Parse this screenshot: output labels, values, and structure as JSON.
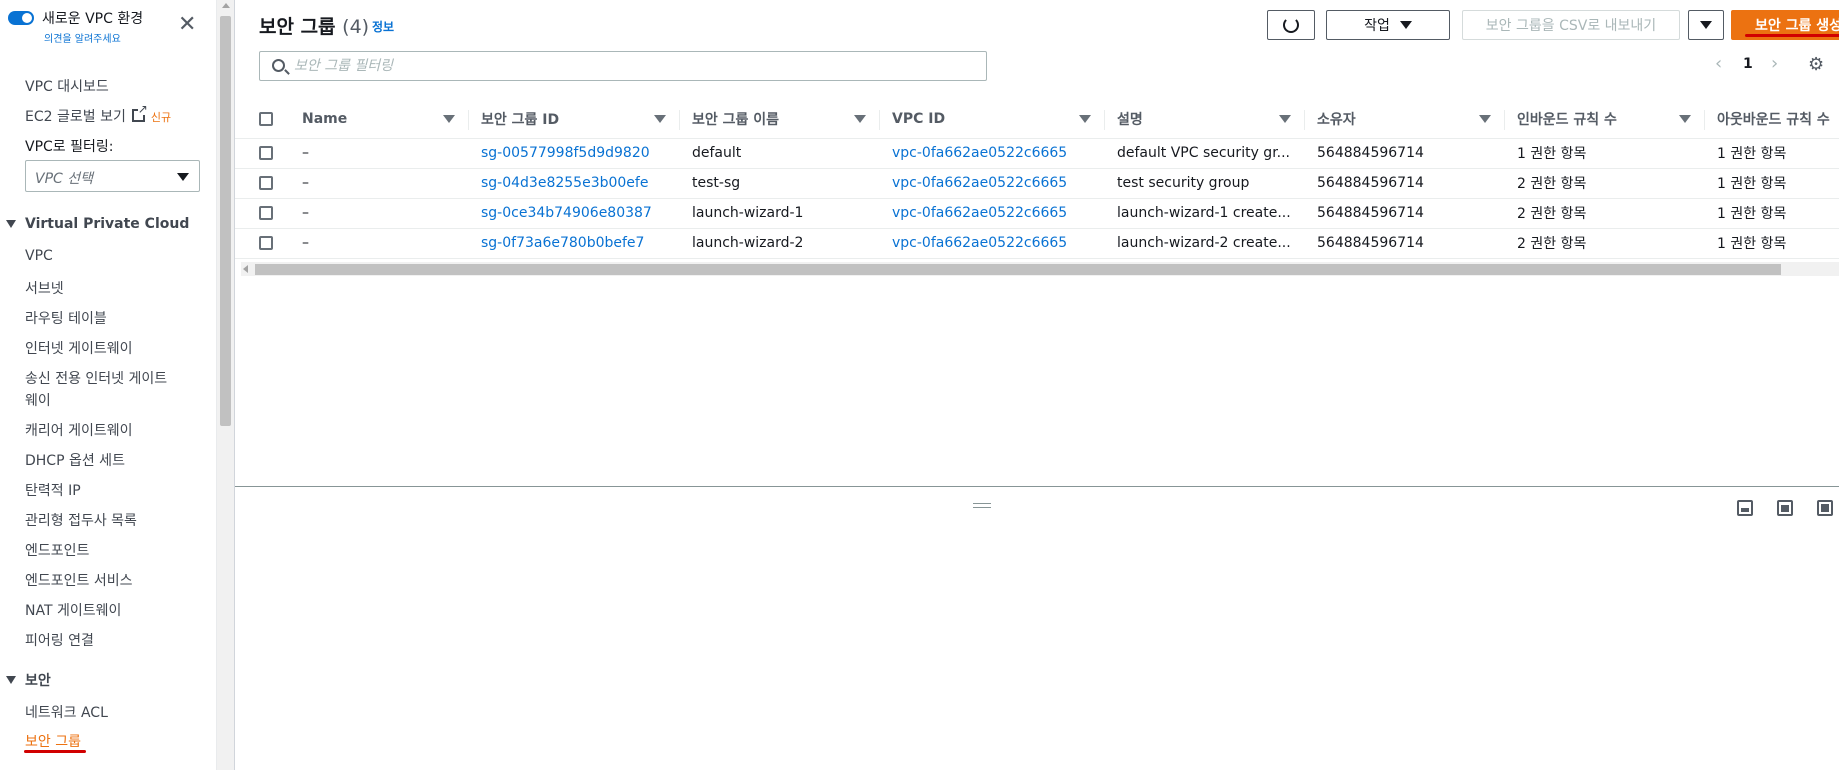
{
  "sidebar": {
    "toggle_title": "새로운 VPC 환경",
    "toggle_sub": "의견을 알려주세요",
    "dashboard": "VPC 대시보드",
    "ec2_global": "EC2 글로벌 보기",
    "new_badge": "신규",
    "filter_label": "VPC로 필터링:",
    "vpc_select_placeholder": "VPC 선택",
    "section_vpc": "Virtual Private Cloud",
    "vpc_items": [
      "VPC",
      "서브넷",
      "라우팅 테이블",
      "인터넷 게이트웨이",
      "송신 전용 인터넷 게이트",
      "웨이",
      "캐리어 게이트웨이",
      "DHCP 옵션 세트",
      "탄력적 IP",
      "관리형 접두사 목록",
      "엔드포인트",
      "엔드포인트 서비스",
      "NAT 게이트웨이",
      "피어링 연결"
    ],
    "section_security": "보안",
    "security_items": [
      "네트워크 ACL",
      "보안 그룹"
    ]
  },
  "header": {
    "title": "보안 그룹",
    "count": "(4)",
    "info": "정보",
    "actions_label": "작업",
    "export_label": "보안 그룹을 CSV로 내보내기",
    "create_label": "보안 그룹 생성"
  },
  "search": {
    "placeholder": "보안 그룹 필터링"
  },
  "pagination": {
    "prev": "‹",
    "page": "1",
    "next": "›"
  },
  "table": {
    "columns": [
      "Name",
      "보안 그룹 ID",
      "보안 그룹 이름",
      "VPC ID",
      "설명",
      "소유자",
      "인바운드 규칙 수",
      "아웃바운드 규칙 수"
    ],
    "rows": [
      [
        "–",
        "sg-00577998f5d9d9820",
        "default",
        "vpc-0fa662ae0522c6665",
        "default VPC security gr...",
        "564884596714",
        "1 권한 항목",
        "1 권한 항목"
      ],
      [
        "–",
        "sg-04d3e8255e3b00efe",
        "test-sg",
        "vpc-0fa662ae0522c6665",
        "test security group",
        "564884596714",
        "2 권한 항목",
        "1 권한 항목"
      ],
      [
        "–",
        "sg-0ce34b74906e80387",
        "launch-wizard-1",
        "vpc-0fa662ae0522c6665",
        "launch-wizard-1 create...",
        "564884596714",
        "2 권한 항목",
        "1 권한 항목"
      ],
      [
        "–",
        "sg-0f73a6e780b0befe7",
        "launch-wizard-2",
        "vpc-0fa662ae0522c6665",
        "launch-wizard-2 create...",
        "564884596714",
        "2 권한 항목",
        "1 권한 항목"
      ]
    ]
  },
  "colors": {
    "accent": "#ec7211",
    "link": "#0972d3",
    "annotation": "#d10000"
  }
}
